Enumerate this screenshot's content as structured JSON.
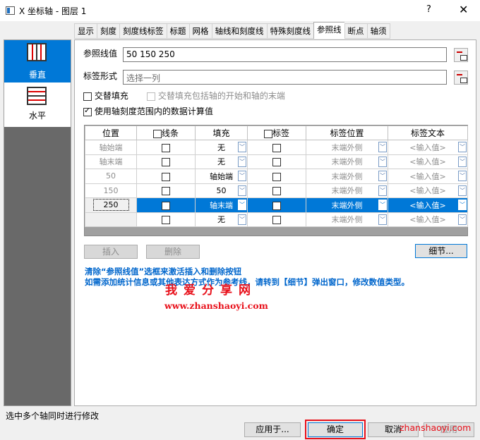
{
  "window": {
    "title": "X 坐标轴 - 图层 1",
    "help": "?",
    "close": "✕"
  },
  "tabs": [
    "显示",
    "刻度",
    "刻度线标签",
    "标题",
    "网格",
    "轴线和刻度线",
    "特殊刻度线",
    "参照线",
    "断点",
    "轴须"
  ],
  "active_tab": "参照线",
  "left_panel": {
    "items": [
      {
        "label": "垂直",
        "selected": true
      },
      {
        "label": "水平",
        "selected": false
      }
    ]
  },
  "form": {
    "ref_label": "参照线值",
    "ref_value": "50 150 250",
    "label_form_label": "标签形式",
    "label_form_value": "选择一列",
    "alt_fill": "交替填充",
    "alt_fill_ends": "交替填充包括轴的开始和轴的末端",
    "use_range": "使用轴刻度范围内的数据计算值"
  },
  "grid": {
    "headers": [
      "位置",
      "线条",
      "填充",
      "标签",
      "标签位置",
      "标签文本"
    ],
    "rows": [
      {
        "pos": "轴始端",
        "fill": "无",
        "labelpos": "末端外侧",
        "text": "<输入值>"
      },
      {
        "pos": "轴末端",
        "fill": "无",
        "labelpos": "末端外侧",
        "text": "<输入值>"
      },
      {
        "pos": "50",
        "fill": "轴始端",
        "labelpos": "末端外侧",
        "text": "<输入值>"
      },
      {
        "pos": "150",
        "fill": "50",
        "labelpos": "末端外侧",
        "text": "<输入值>"
      },
      {
        "pos": "250",
        "fill": "轴末端",
        "labelpos": "末端外侧",
        "text": "<输入值>"
      },
      {
        "pos": "",
        "fill": "无",
        "labelpos": "末端外侧",
        "text": "<输入值>"
      }
    ]
  },
  "buttons": {
    "insert": "插入",
    "delete": "删除",
    "details": "细节...",
    "apply": "应用于...",
    "ok": "确定",
    "cancel": "取消",
    "help": "应用"
  },
  "info": {
    "line1": "清除“参照线值”选框来激活插入和删除按钮",
    "line2": "如需添加统计信息或其他表达方式作为参考线，请转到【细节】弹出窗口，修改数值类型。"
  },
  "watermark": {
    "cn": "我爱分享网",
    "url": "www.zhanshaoyi.com",
    "url2": "zhanshaoyi.com"
  },
  "status": "选中多个轴同时进行修改"
}
